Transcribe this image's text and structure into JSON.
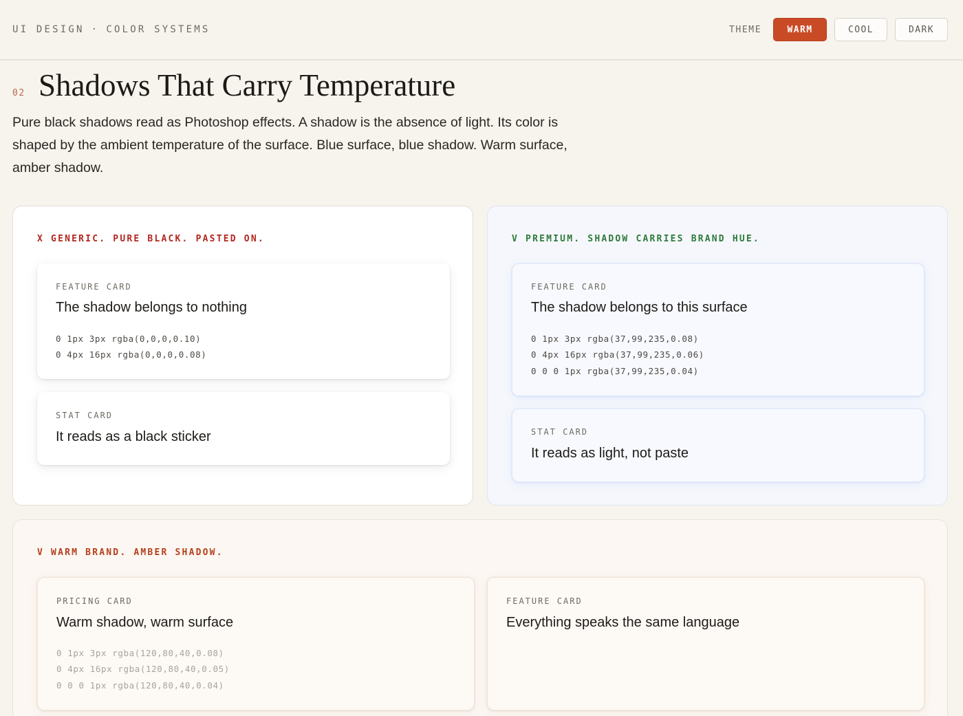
{
  "header": {
    "crumb_1": "UI DESIGN",
    "crumb_sep": "·",
    "crumb_2": "COLOR SYSTEMS",
    "theme_label": "THEME",
    "theme_options": [
      {
        "label": "WARM",
        "active": true
      },
      {
        "label": "COOL",
        "active": false
      },
      {
        "label": "DARK",
        "active": false
      }
    ]
  },
  "section": {
    "number": "02",
    "title": "Shadows That Carry Temperature",
    "lead": "Pure black shadows read as Photoshop effects. A shadow is the absence of light. Its color is shaped by the ambient temperature of the surface. Blue surface, blue shadow. Warm surface, amber shadow."
  },
  "generic_panel": {
    "label": "X GENERIC. PURE BLACK. PASTED ON.",
    "feature_card": {
      "eyebrow": "FEATURE CARD",
      "heading": "The shadow belongs to nothing",
      "specs": [
        "0 1px 3px rgba(0,0,0,0.10)",
        "0 4px 16px rgba(0,0,0,0.08)"
      ]
    },
    "stat_card": {
      "eyebrow": "STAT CARD",
      "heading": "It reads as a black sticker"
    }
  },
  "premium_panel": {
    "label": "V PREMIUM. SHADOW CARRIES BRAND HUE.",
    "feature_card": {
      "eyebrow": "FEATURE CARD",
      "heading": "The shadow belongs to this surface",
      "specs": [
        "0 1px 3px rgba(37,99,235,0.08)",
        "0 4px 16px rgba(37,99,235,0.06)",
        "0 0 0 1px rgba(37,99,235,0.04)"
      ]
    },
    "stat_card": {
      "eyebrow": "STAT CARD",
      "heading": "It reads as light, not paste"
    }
  },
  "warm_panel": {
    "label": "V WARM BRAND. AMBER SHADOW.",
    "pricing_card": {
      "eyebrow": "PRICING CARD",
      "heading": "Warm shadow, warm surface",
      "specs": [
        "0 1px 3px rgba(120,80,40,0.08)",
        "0 4px 16px rgba(120,80,40,0.05)",
        "0 0 0 1px rgba(120,80,40,0.04)"
      ]
    },
    "feature_card": {
      "eyebrow": "FEATURE CARD",
      "heading": "Everything speaks the same language"
    }
  },
  "colors": {
    "accent_warm": "#c94b26",
    "bad_label": "#b3261e",
    "good_label": "#2f7a3b",
    "warm_label": "#b3401c",
    "page_bg": "#f7f4ee"
  }
}
